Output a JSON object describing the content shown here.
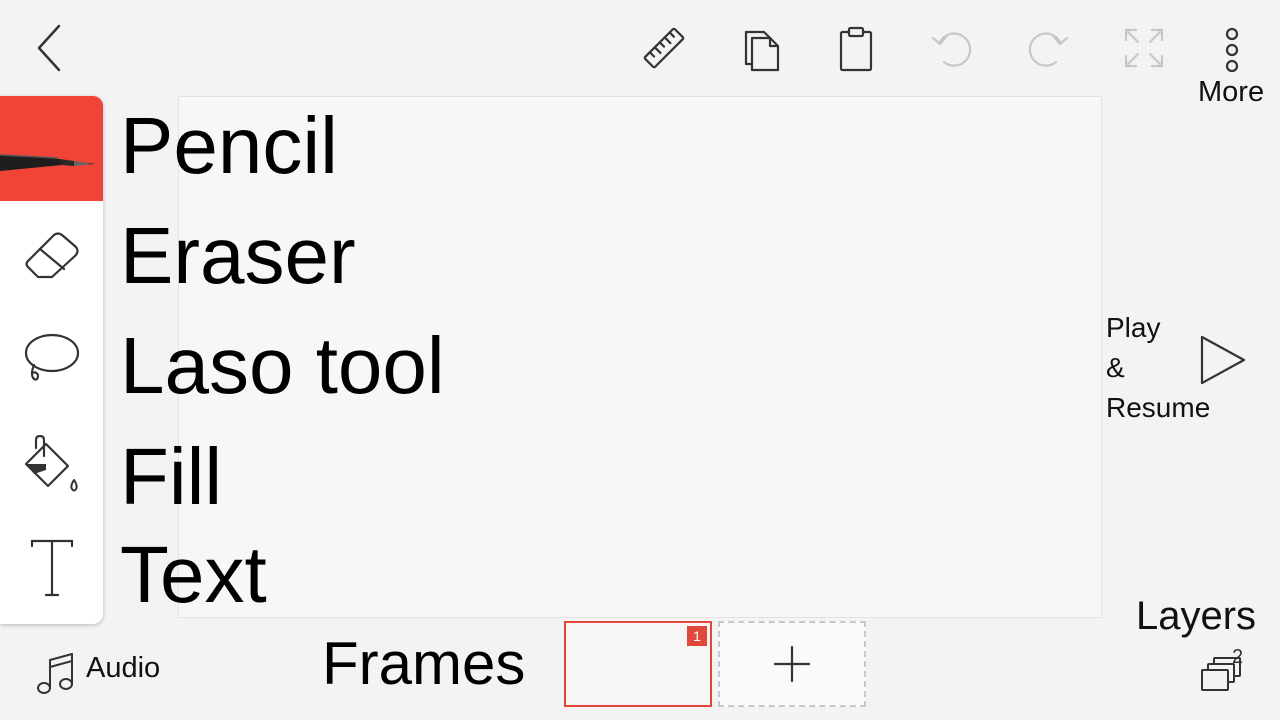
{
  "toolbar": {
    "back_icon": "chevron-left-icon",
    "ruler_icon": "ruler-icon",
    "copy_icon": "copy-icon",
    "paste_icon": "clipboard-icon",
    "undo_icon": "undo-icon",
    "redo_icon": "redo-icon",
    "fullscreen_icon": "expand-icon",
    "more_icon": "more-vertical-icon",
    "more_label": "More"
  },
  "tools": [
    {
      "icon": "pen-icon",
      "label": "Pencil",
      "selected": true
    },
    {
      "icon": "eraser-icon",
      "label": "Eraser",
      "selected": false
    },
    {
      "icon": "lasso-icon",
      "label": "Laso tool",
      "selected": false
    },
    {
      "icon": "paint-bucket-icon",
      "label": "Fill",
      "selected": false
    },
    {
      "icon": "text-icon",
      "label": "Text",
      "selected": false
    }
  ],
  "play": {
    "line1": "Play",
    "line2": "&",
    "line3": "Resume",
    "icon": "play-icon"
  },
  "layers": {
    "label": "Layers",
    "count": "2",
    "icon": "layers-icon"
  },
  "audio": {
    "label": "Audio",
    "icon": "music-note-icon"
  },
  "frames": {
    "label": "Frames",
    "items": [
      {
        "number": "1",
        "selected": true
      }
    ],
    "add_icon": "plus-icon"
  },
  "colors": {
    "accent": "#ef4437",
    "background": "#f3f3f3",
    "canvas": "#f8f7f5"
  }
}
